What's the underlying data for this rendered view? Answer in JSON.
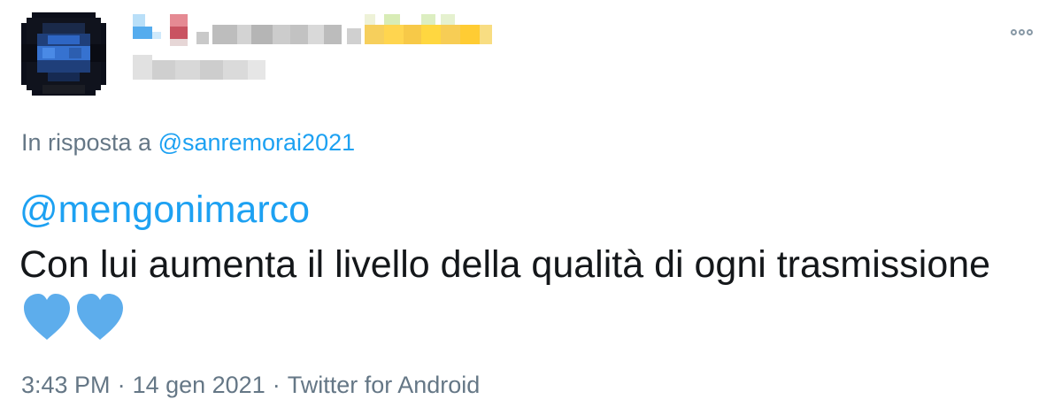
{
  "reply": {
    "prefix": "In risposta a",
    "handle": "@sanremorai2021"
  },
  "tweet": {
    "mention": "@mengonimarco",
    "text": "Con lui aumenta il livello della qualità di ogni trasmissione",
    "emoji": [
      "light-blue-heart",
      "light-blue-heart"
    ]
  },
  "footer": {
    "time": "3:43 PM",
    "date": "14 gen 2021",
    "source": "Twitter for Android",
    "separator": "·"
  },
  "colors": {
    "link": "#1da1f2",
    "muted": "#657786",
    "text": "#14171a",
    "heart": "#5dadec"
  },
  "icons": {
    "more": "more-options-icon",
    "avatar": "pixelated-avatar"
  }
}
